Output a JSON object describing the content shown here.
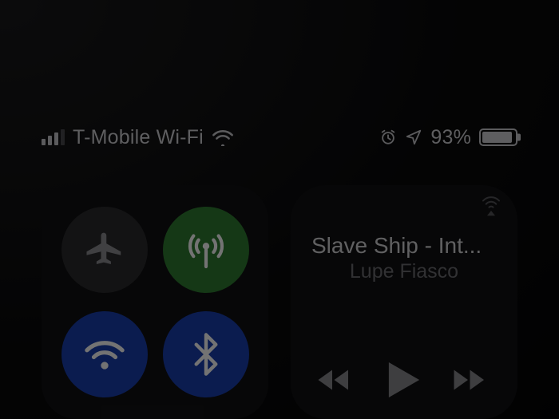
{
  "status": {
    "carrier": "T-Mobile Wi-Fi",
    "signal_bars_active": 3,
    "signal_bars_total": 4,
    "battery_pct_label": "93%",
    "battery_fill_pct": 93,
    "alarm_set": true,
    "location_active": true
  },
  "connectivity": {
    "airplane": {
      "active": false,
      "icon": "airplane-icon"
    },
    "cellular": {
      "active": true,
      "icon": "cellular-antenna-icon",
      "color": "#2f7d32"
    },
    "wifi": {
      "active": true,
      "icon": "wifi-icon",
      "color": "#1a3fb0"
    },
    "bluetooth": {
      "active": true,
      "icon": "bluetooth-icon",
      "color": "#1a3fb0"
    }
  },
  "media": {
    "title": "Slave Ship - Int...",
    "artist": "Lupe Fiasco",
    "state": "paused",
    "airplay_available": true
  },
  "icons": {
    "airplane": "airplane-icon",
    "cellular": "cellular-antenna-icon",
    "wifi": "wifi-icon",
    "bluetooth": "bluetooth-icon",
    "alarm": "alarm-icon",
    "location": "location-arrow-icon",
    "airplay": "airplay-icon",
    "prev": "previous-track-icon",
    "play": "play-icon",
    "next": "next-track-icon"
  }
}
